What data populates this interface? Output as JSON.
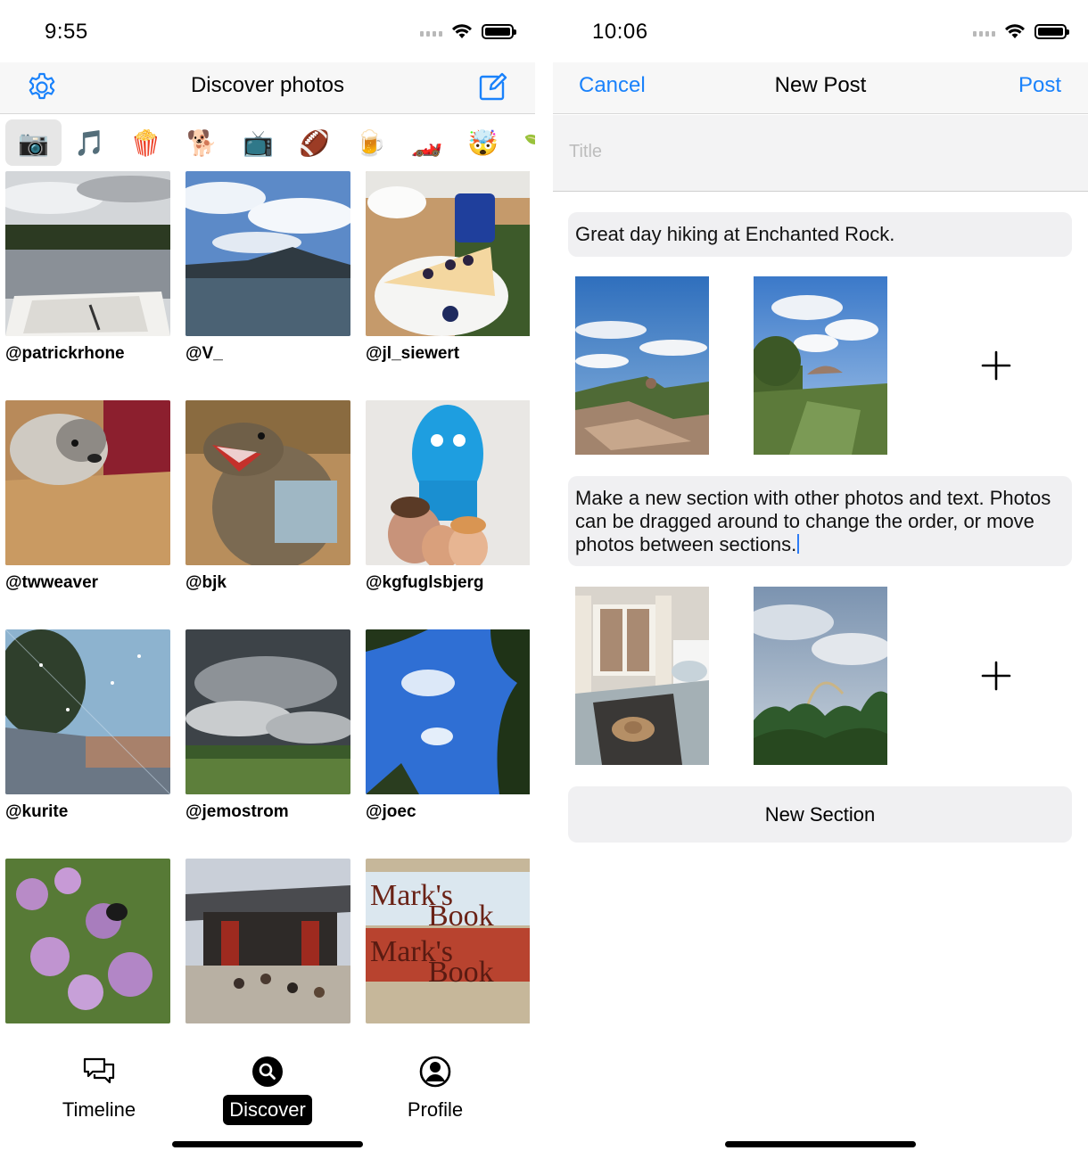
{
  "left": {
    "status": {
      "time": "9:55"
    },
    "nav": {
      "title": "Discover photos",
      "settings_icon": "gear-icon",
      "compose_icon": "compose-icon"
    },
    "categories": [
      "📷",
      "🎵",
      "🍿",
      "🐕",
      "📺",
      "🏈",
      "🍺",
      "🏎️",
      "🤯",
      "🌱"
    ],
    "selected_category": 0,
    "photos": [
      {
        "user": "@patrickrhone",
        "scene": "lake-notebook"
      },
      {
        "user": "@V_",
        "scene": "mountain-lake"
      },
      {
        "user": "@jl_siewert",
        "scene": "cake-table"
      },
      {
        "user": "@twweaver",
        "scene": "dog"
      },
      {
        "user": "@bjk",
        "scene": "dino-toy"
      },
      {
        "user": "@kgfuglsbjerg",
        "scene": "blue-monster"
      },
      {
        "user": "@kurite",
        "scene": "sprinkler"
      },
      {
        "user": "@jemostrom",
        "scene": "storm-field"
      },
      {
        "user": "@joec",
        "scene": "trees-sky"
      },
      {
        "user": "",
        "scene": "flowers"
      },
      {
        "user": "",
        "scene": "temple"
      },
      {
        "user": "",
        "scene": "bookshop"
      }
    ],
    "tabs": [
      {
        "label": "Timeline",
        "icon": "chat-bubbles-icon"
      },
      {
        "label": "Discover",
        "icon": "search-circle-icon"
      },
      {
        "label": "Profile",
        "icon": "person-circle-icon"
      }
    ],
    "active_tab": "Discover"
  },
  "right": {
    "status": {
      "time": "10:06"
    },
    "nav": {
      "cancel": "Cancel",
      "title": "New Post",
      "post": "Post"
    },
    "title_placeholder": "Title",
    "sections": [
      {
        "text": "Great day hiking at Enchanted Rock.",
        "photos": [
          "rock-landscape",
          "rock-trees"
        ]
      },
      {
        "text": "Make a new section with other photos and text. Photos can be dragged around to change the order, or move photos between sections.",
        "photos": [
          "bedroom",
          "rainbow-trees"
        ]
      }
    ],
    "new_section_label": "New Section"
  },
  "colors": {
    "accent": "#1a82fb"
  }
}
